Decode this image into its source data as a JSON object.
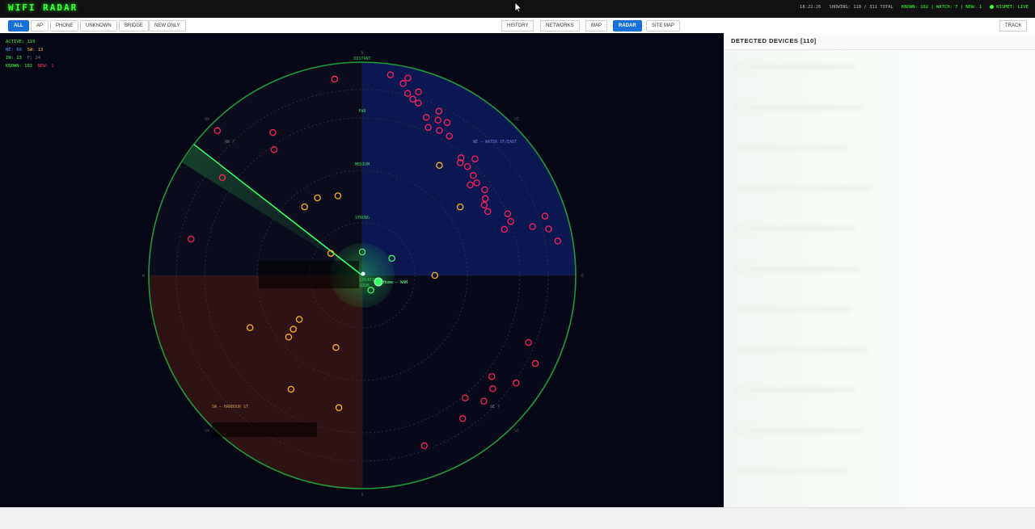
{
  "app": {
    "title": "WIFI RADAR"
  },
  "status": {
    "clock": "18:22:26",
    "showing": "SHOWING: 110 / 311 TOTAL",
    "counts": "KNOWN: 102 | WATCH: 7 | NEW: 1",
    "kismet": "KISMET: LIVE"
  },
  "filters": {
    "all": "ALL",
    "ap": "AP",
    "phone": "PHONE",
    "unknown": "UNKNOWN",
    "bridge": "BRIDGE",
    "new_only": "NEW ONLY"
  },
  "views": {
    "history": "HISTORY",
    "networks": "NETWORKS",
    "map": "MAP",
    "radar": "RADAR",
    "site_map": "SITE MAP"
  },
  "track": "TRACK",
  "stats": {
    "active": "ACTIVE: 110",
    "ne": "NE: 60",
    "sw": "SW: 13",
    "in": "IN: 13",
    "f": "F: 24",
    "known": "KNOWN: 102",
    "new": "NEW: 1"
  },
  "radar": {
    "rings": {
      "distant": "DISTANT",
      "far": "FAR",
      "medium": "MEDIUM",
      "strong": "STRONG"
    },
    "quadrants": {
      "nw": "NW ?",
      "ne": "NE — WATER ST/EAST",
      "sw": "SW — HARBOUR ST",
      "se": "SE ?"
    },
    "compass": {
      "n": "N",
      "e": "E",
      "s": "S",
      "w": "W",
      "nw": "NW",
      "ne": "NE",
      "sw": "SW",
      "se": "SE"
    },
    "center": {
      "line1": "LOCATION",
      "line2": "SIDE",
      "tag": "Home – WAN"
    }
  },
  "colors": {
    "known": "#ff2255",
    "watch": "#ffb020",
    "inside": "#33ff66",
    "sweep": "#33ff66",
    "ne_sector": "#0c1a5c",
    "sw_sector": "#3a1512",
    "primary_button": "#1670d6"
  },
  "devices": [
    {
      "a": -8,
      "d": 0.93,
      "t": "known"
    },
    {
      "a": 8,
      "d": 0.95,
      "t": "known"
    },
    {
      "a": 12,
      "d": 0.92,
      "t": "known"
    },
    {
      "a": 13,
      "d": 0.95,
      "t": "known"
    },
    {
      "a": 14,
      "d": 0.88,
      "t": "known"
    },
    {
      "a": 16,
      "d": 0.86,
      "t": "known"
    },
    {
      "a": 18,
      "d": 0.85,
      "t": "known"
    },
    {
      "a": 17,
      "d": 0.9,
      "t": "known"
    },
    {
      "a": 22,
      "d": 0.8,
      "t": "known"
    },
    {
      "a": 25,
      "d": 0.85,
      "t": "known"
    },
    {
      "a": 26,
      "d": 0.81,
      "t": "known"
    },
    {
      "a": 29,
      "d": 0.82,
      "t": "known"
    },
    {
      "a": 24,
      "d": 0.76,
      "t": "known"
    },
    {
      "a": 28,
      "d": 0.77,
      "t": "known"
    },
    {
      "a": 32,
      "d": 0.77,
      "t": "known"
    },
    {
      "a": 40,
      "d": 0.72,
      "t": "known"
    },
    {
      "a": 41,
      "d": 0.7,
      "t": "known"
    },
    {
      "a": 44,
      "d": 0.71,
      "t": "known"
    },
    {
      "a": 44,
      "d": 0.76,
      "t": "known"
    },
    {
      "a": 48,
      "d": 0.7,
      "t": "known"
    },
    {
      "a": 50,
      "d": 0.66,
      "t": "known"
    },
    {
      "a": 51,
      "d": 0.69,
      "t": "known"
    },
    {
      "a": 55,
      "d": 0.7,
      "t": "known"
    },
    {
      "a": 58,
      "d": 0.68,
      "t": "known"
    },
    {
      "a": 60,
      "d": 0.66,
      "t": "known"
    },
    {
      "a": 63,
      "d": 0.66,
      "t": "known"
    },
    {
      "a": 67,
      "d": 0.74,
      "t": "known"
    },
    {
      "a": 70,
      "d": 0.74,
      "t": "known"
    },
    {
      "a": 72,
      "d": 0.7,
      "t": "known"
    },
    {
      "a": 74,
      "d": 0.83,
      "t": "known"
    },
    {
      "a": 72,
      "d": 0.9,
      "t": "known"
    },
    {
      "a": 76,
      "d": 0.9,
      "t": "known"
    },
    {
      "a": 80,
      "d": 0.93,
      "t": "known"
    },
    {
      "a": 112,
      "d": 0.84,
      "t": "known"
    },
    {
      "a": 117,
      "d": 0.91,
      "t": "known"
    },
    {
      "a": 125,
      "d": 0.88,
      "t": "known"
    },
    {
      "a": 128,
      "d": 0.77,
      "t": "known"
    },
    {
      "a": 131,
      "d": 0.81,
      "t": "known"
    },
    {
      "a": 136,
      "d": 0.82,
      "t": "known"
    },
    {
      "a": 140,
      "d": 0.75,
      "t": "known"
    },
    {
      "a": 145,
      "d": 0.82,
      "t": "known"
    },
    {
      "a": 160,
      "d": 0.85,
      "t": "known"
    },
    {
      "a": -45,
      "d": 0.96,
      "t": "known"
    },
    {
      "a": -32,
      "d": 0.79,
      "t": "known"
    },
    {
      "a": -35,
      "d": 0.72,
      "t": "known"
    },
    {
      "a": -55,
      "d": 0.8,
      "t": "known"
    },
    {
      "a": -78,
      "d": 0.82,
      "t": "known"
    },
    {
      "a": -55,
      "d": 0.18,
      "t": "watch"
    },
    {
      "a": -40,
      "d": 0.42,
      "t": "watch"
    },
    {
      "a": -30,
      "d": 0.42,
      "t": "watch"
    },
    {
      "a": -17,
      "d": 0.39,
      "t": "watch"
    },
    {
      "a": 35,
      "d": 0.63,
      "t": "watch"
    },
    {
      "a": 55,
      "d": 0.56,
      "t": "watch"
    },
    {
      "a": 90,
      "d": 0.34,
      "t": "watch"
    },
    {
      "a": -130,
      "d": 0.45,
      "t": "watch"
    },
    {
      "a": -128,
      "d": 0.41,
      "t": "watch"
    },
    {
      "a": -125,
      "d": 0.36,
      "t": "watch"
    },
    {
      "a": -115,
      "d": 0.58,
      "t": "watch"
    },
    {
      "a": -160,
      "d": 0.36,
      "t": "watch"
    },
    {
      "a": -148,
      "d": 0.63,
      "t": "watch"
    },
    {
      "a": -170,
      "d": 0.63,
      "t": "watch"
    },
    {
      "a": 60,
      "d": 0.16,
      "t": "inside"
    },
    {
      "a": 0,
      "d": 0.11,
      "t": "inside"
    },
    {
      "a": 150,
      "d": 0.08,
      "t": "inside"
    }
  ]
}
